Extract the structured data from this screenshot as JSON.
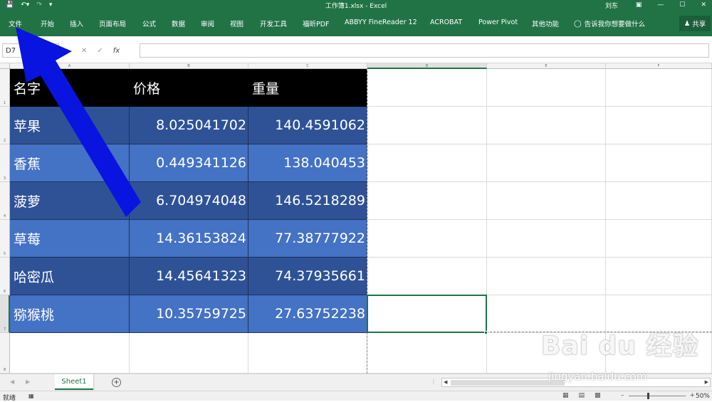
{
  "app": {
    "title": "工作簿1.xlsx  -  Excel",
    "user": "刘东",
    "accent": "#217346"
  },
  "ribbon": {
    "tabs": [
      "文件",
      "开始",
      "插入",
      "页面布局",
      "公式",
      "数据",
      "审阅",
      "视图",
      "开发工具",
      "福昕PDF",
      "ABBYY FineReader 12",
      "ACROBAT",
      "Power Pivot",
      "其他功能"
    ],
    "search": "告诉我你想要做什么",
    "share": "共享"
  },
  "formula_bar": {
    "name_box": "D7",
    "cancel": "✕",
    "enter": "✓",
    "fx": "fx",
    "formula": ""
  },
  "columns": [
    "A",
    "B",
    "C",
    "D",
    "E",
    "F"
  ],
  "rows": [
    "1",
    "2",
    "3",
    "4",
    "5",
    "6",
    "7",
    "8"
  ],
  "table": {
    "headers": [
      "名字",
      "价格",
      "重量"
    ],
    "rows": [
      [
        "苹果",
        "8.025041702",
        "140.4591062"
      ],
      [
        "香蕉",
        "0.449341126",
        "138.040453"
      ],
      [
        "菠萝",
        "6.704974048",
        "146.5218289"
      ],
      [
        "草莓",
        "14.36153824",
        "77.38777922"
      ],
      [
        "哈密瓜",
        "14.45641323",
        "74.37935661"
      ],
      [
        "猕猴桃",
        "10.35759725",
        "27.63752238"
      ]
    ],
    "colors": {
      "header": "#000000",
      "dark": "#2f5297",
      "light": "#4472c4"
    }
  },
  "selected_cell": "D7",
  "sheets": [
    "Sheet1"
  ],
  "status": {
    "ready": "就绪",
    "zoom": "50%"
  },
  "annotation": {
    "arrow_color": "#0a14e0",
    "icon": "blue-arrow-pointing-to-file-tab"
  },
  "watermark": {
    "brand": "Bai du 经验",
    "url": "jingyan.baidu.com"
  }
}
